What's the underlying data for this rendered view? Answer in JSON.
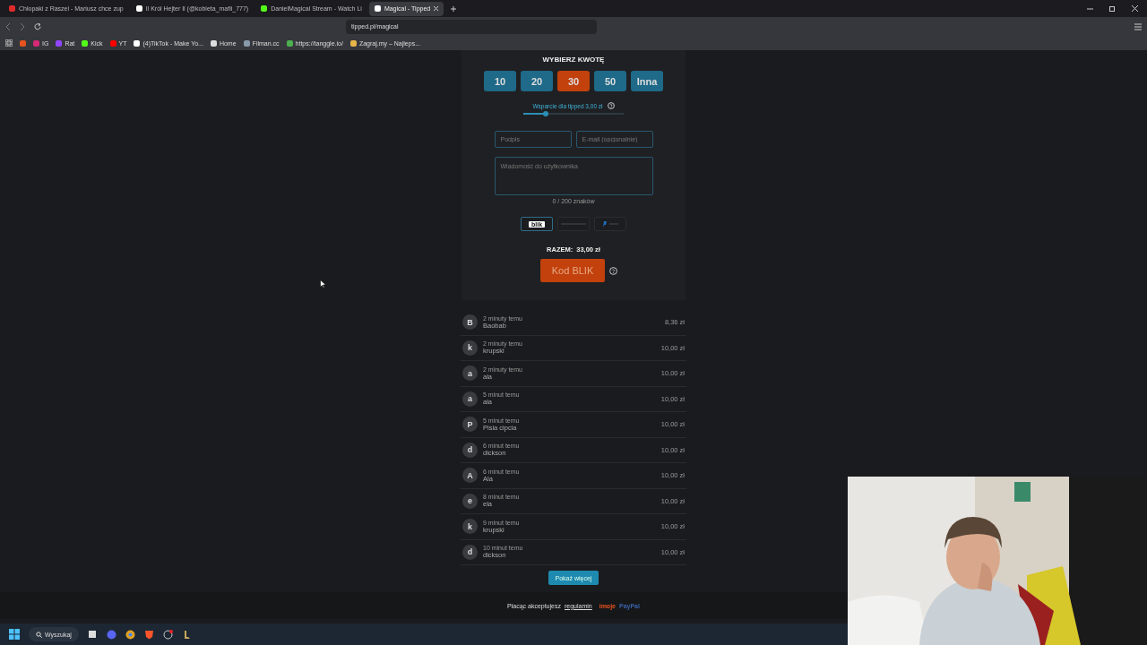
{
  "tabs": [
    {
      "label": "Chłopaki z Raszei - Mariusz chce zup",
      "selected": false,
      "color": "#e02b2b"
    },
    {
      "label": "Il Król Hejter Il (@kobieta_mafii_777)",
      "selected": false,
      "color": "#ffffff"
    },
    {
      "label": "DanielMagical Stream - Watch Li",
      "selected": false,
      "color": "#53fc18"
    },
    {
      "label": "Magical - Tipped",
      "selected": true,
      "color": "#ffffff"
    }
  ],
  "address": "tipped.pl/magical",
  "bookmarks": [
    {
      "color": "#e8531d"
    },
    {
      "label": "IG",
      "color": "#d62976"
    },
    {
      "label": "Rat",
      "color": "#9146ff"
    },
    {
      "label": "Kick",
      "color": "#53fc18"
    },
    {
      "label": "YT",
      "color": "#ff0000"
    },
    {
      "label": "(4)TikTok - Make Yo...",
      "color": "#ffffff"
    },
    {
      "label": "Home",
      "color": "#dddddd"
    },
    {
      "label": "Filman.cc",
      "color": "#8899aa"
    },
    {
      "label": "https://tanggle.io/",
      "color": "#4caf50"
    },
    {
      "label": "Zagraj.my – Najleps...",
      "color": "#e8b44a"
    }
  ],
  "form": {
    "heading": "WYBIERZ KWOTĘ",
    "amounts": [
      {
        "label": "10",
        "selected": false
      },
      {
        "label": "20",
        "selected": false
      },
      {
        "label": "30",
        "selected": true
      },
      {
        "label": "50",
        "selected": false
      },
      {
        "label": "Inna",
        "selected": false
      }
    ],
    "support_label": "Wsparcie dla tipped 3,00 zł",
    "support_slider": {
      "level": 0.22
    },
    "signature": {
      "placeholder": "Podpis"
    },
    "email": {
      "placeholder": "E-mail (opcjonalnie)"
    },
    "message": {
      "placeholder": "Wiadomość do użytkownika"
    },
    "counter": "0 / 200 znaków",
    "methods": [
      {
        "kind": "blik",
        "label": "blik",
        "selected": true
      },
      {
        "kind": "transfer",
        "selected": false
      },
      {
        "kind": "paypal",
        "selected": false
      }
    ],
    "total_label": "RAZEM:",
    "total": "33,00 zł",
    "submit": "Kod BLIK"
  },
  "tips": [
    {
      "initial": "B",
      "time": "2 minuty temu",
      "name": "Baobab",
      "amount": "8,36 zł"
    },
    {
      "initial": "k",
      "time": "2 minuty temu",
      "name": "krupski",
      "amount": "10,00 zł"
    },
    {
      "initial": "a",
      "time": "2 minuty temu",
      "name": "ala",
      "amount": "10,00 zł"
    },
    {
      "initial": "a",
      "time": "5 minut temu",
      "name": "ala",
      "amount": "10,00 zł"
    },
    {
      "initial": "P",
      "time": "5 minut temu",
      "name": "Pisia cipcia",
      "amount": "10,00 zł"
    },
    {
      "initial": "d",
      "time": "6 minut temu",
      "name": "dickson",
      "amount": "10,00 zł"
    },
    {
      "initial": "A",
      "time": "6 minut temu",
      "name": "Ala",
      "amount": "10,00 zł"
    },
    {
      "initial": "e",
      "time": "8 minut temu",
      "name": "ela",
      "amount": "10,00 zł"
    },
    {
      "initial": "k",
      "time": "9 minut temu",
      "name": "krupski",
      "amount": "10,00 zł"
    },
    {
      "initial": "d",
      "time": "10 minut temu",
      "name": "dickson",
      "amount": "10,00 zł"
    }
  ],
  "show_more": "Pokaż więcej",
  "footer": {
    "text": "Płacąc akceptujesz",
    "link": "regulamin",
    "brand": "imoje",
    "paypal": "PayPal"
  },
  "taskbar": {
    "search": "Wyszukaj"
  }
}
